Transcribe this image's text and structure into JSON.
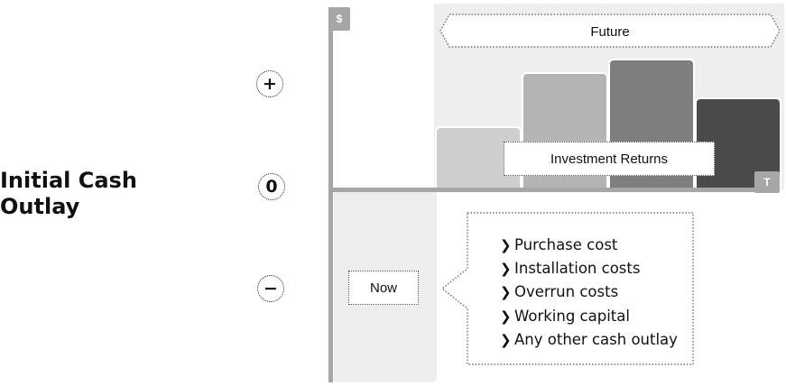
{
  "title_lines": [
    "Initial Cash",
    "Outlay"
  ],
  "signs": {
    "plus": "+",
    "zero": "0",
    "minus": "−"
  },
  "axes": {
    "y_label": "$",
    "x_label": "T"
  },
  "labels": {
    "future": "Future",
    "now": "Now",
    "returns": "Investment Returns"
  },
  "outlay_items": [
    "Purchase cost",
    "Installation costs",
    "Overrun costs",
    "Working capital",
    "Any other cash outlay"
  ],
  "chart_data": {
    "type": "bar",
    "categories": [
      "",
      "",
      "",
      ""
    ],
    "values": [
      70,
      130,
      145,
      102
    ],
    "ylim": [
      0,
      150
    ],
    "colors": [
      "#cfcfcf",
      "#b4b4b4",
      "#7e7e7e",
      "#4b4b4b"
    ]
  },
  "colors": {
    "axis": "#a6a6a6",
    "panel": "#eeeeee"
  }
}
